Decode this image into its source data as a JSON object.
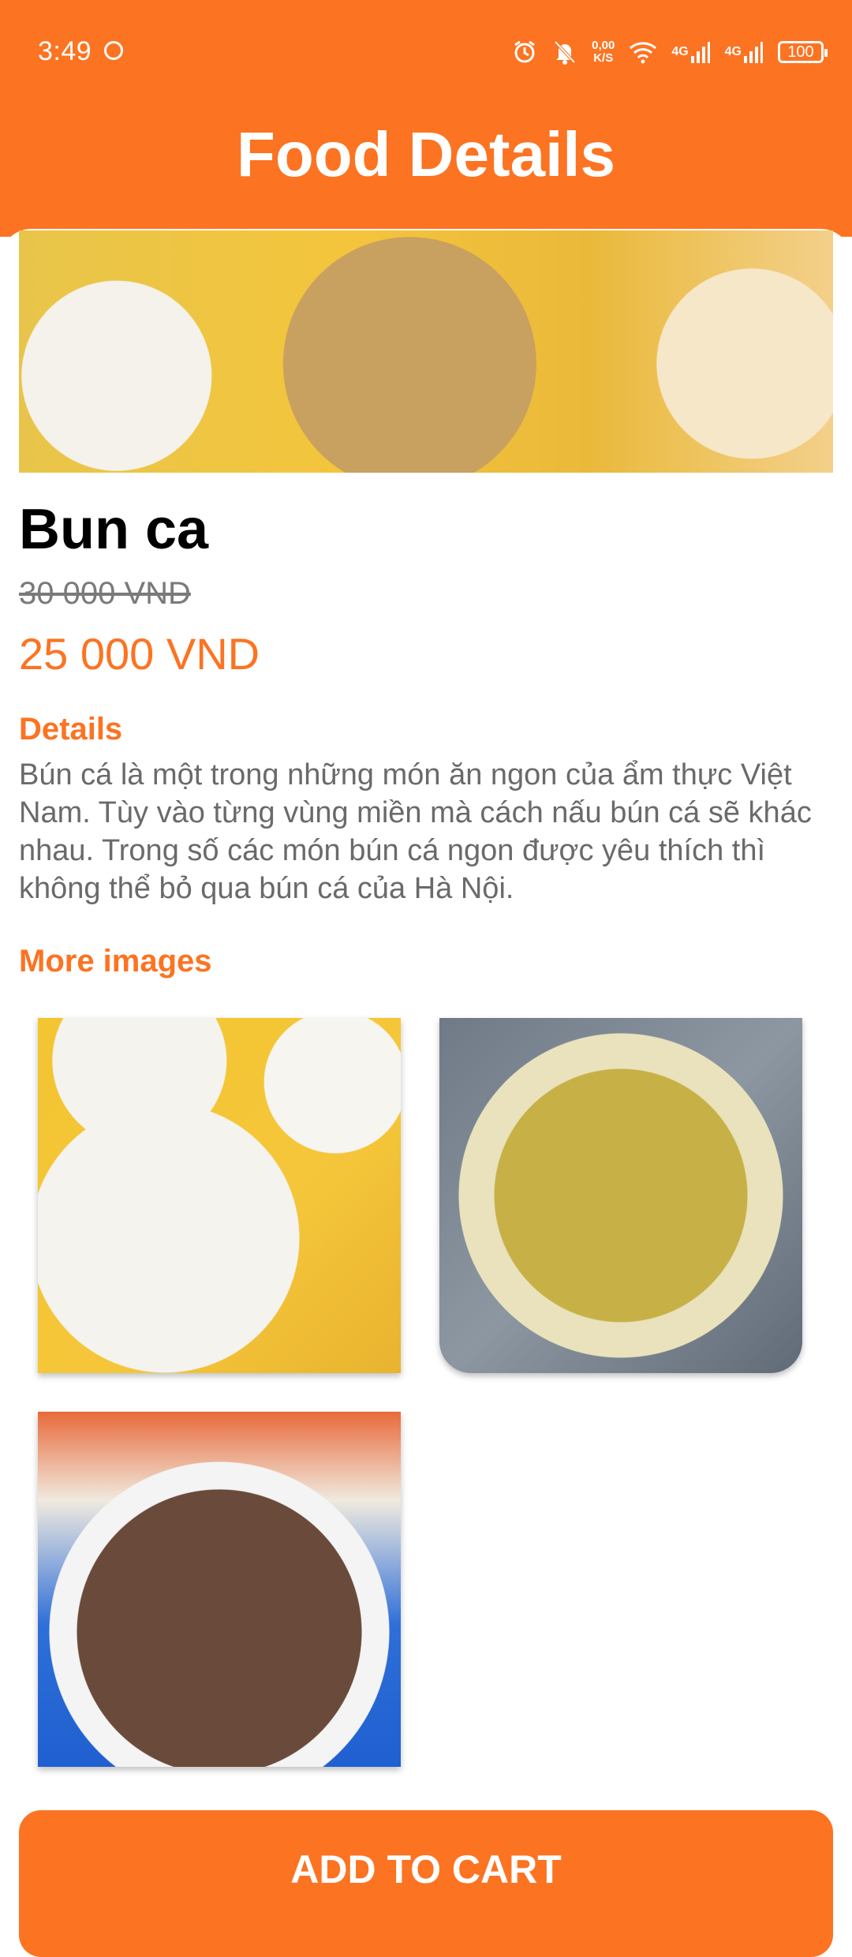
{
  "status_bar": {
    "time": "3:49",
    "net_speed_value": "0,00",
    "net_speed_unit": "K/S",
    "signal_1": "4G",
    "signal_2": "4G",
    "battery": "100"
  },
  "header": {
    "title": "Food Details"
  },
  "food": {
    "name": "Bun ca",
    "old_price": "30 000 VND",
    "price": "25 000 VND"
  },
  "details": {
    "heading": "Details",
    "text": "Bún cá là một trong những món ăn ngon của ẩm thực Việt Nam. Tùy vào từng vùng miền mà cách nấu bún cá sẽ khác nhau. Trong số các món bún cá ngon được yêu thích thì không thể bỏ qua bún cá của Hà Nội."
  },
  "more_images": {
    "heading": "More images"
  },
  "actions": {
    "add_to_cart": "ADD TO CART"
  },
  "colors": {
    "accent": "#FC7322",
    "text_muted": "#6a6a6a"
  },
  "icons": [
    "status-face-icon",
    "alarm-icon",
    "mute-icon",
    "wifi-icon",
    "signal-icon",
    "battery-icon"
  ]
}
